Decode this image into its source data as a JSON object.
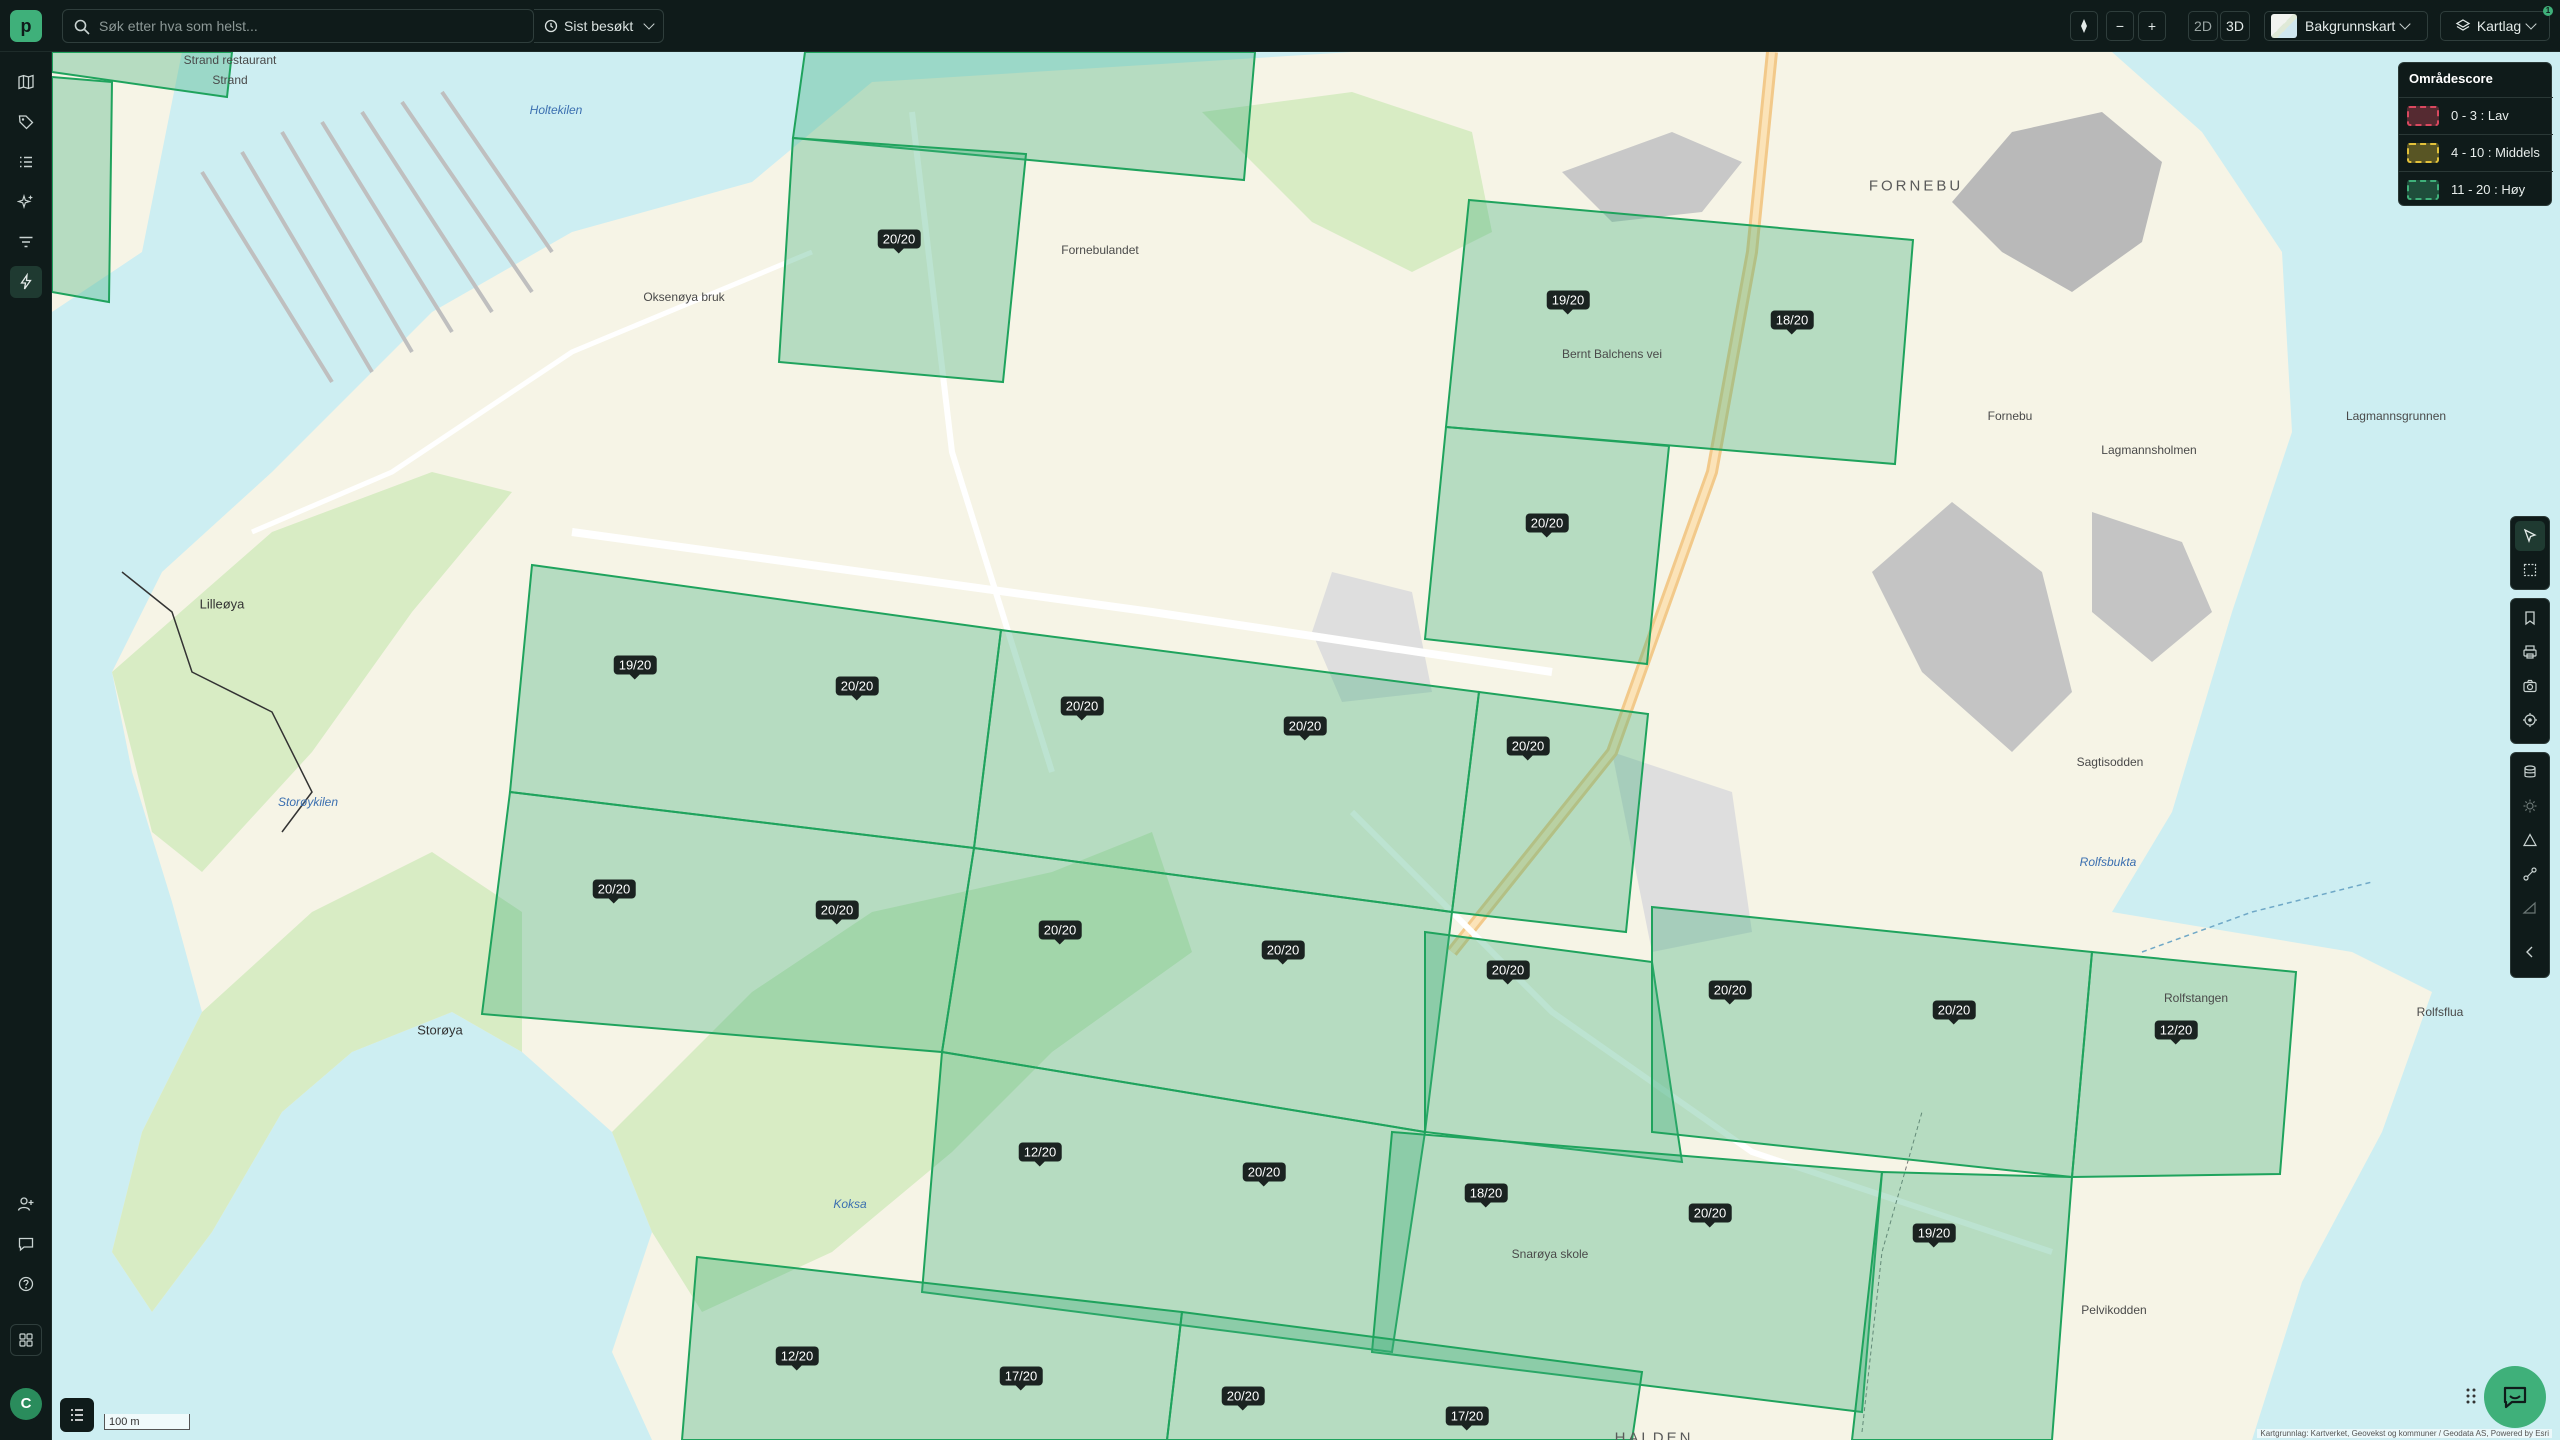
{
  "app": {
    "logo_letter": "p"
  },
  "search": {
    "placeholder": "Søk etter hva som helst..."
  },
  "toolbar": {
    "recent_label": "Sist besøkt",
    "zoom_out": "−",
    "zoom_in": "+",
    "view_2d": "2D",
    "view_3d": "3D",
    "basemap_label": "Bakgrunnskart",
    "layers_label": "Kartlag",
    "layers_badge": "1"
  },
  "user": {
    "avatar_initial": "C"
  },
  "legend": {
    "title": "Områdescore",
    "items": [
      {
        "label": "0 - 3 : Lav",
        "color": "#d9485f"
      },
      {
        "label": "4 - 10 : Middels",
        "color": "#e3c23a"
      },
      {
        "label": "11 - 20 : Høy",
        "color": "#3fb07a"
      }
    ]
  },
  "scores": [
    "20/20",
    "19/20",
    "18/20",
    "20/20",
    "19/20",
    "20/20",
    "20/20",
    "20/20",
    "20/20",
    "20/20",
    "20/20",
    "20/20",
    "20/20",
    "20/20",
    "20/20",
    "20/20",
    "12/20",
    "12/20",
    "20/20",
    "18/20",
    "20/20",
    "19/20",
    "12/20",
    "17/20",
    "20/20",
    "17/20"
  ],
  "places": {
    "strand_restaurant": "Strand restaurant",
    "strand": "Strand",
    "holtekilen": "Holtekilen",
    "oksenoya_bruk": "Oksenøya bruk",
    "fornebulandet": "Fornebulandet",
    "fornebu": "FORNEBU",
    "fornebu_small": "Fornebu",
    "lagmannsholmen": "Lagmannsholmen",
    "lagmannsgrunnen": "Lagmannsgrunnen",
    "lilleoya": "Lilleøya",
    "storoykilen": "Storøykilen",
    "storoya": "Storøya",
    "koksa": "Koksa",
    "saglisodden": "Sagtisodden",
    "rolfsbukta": "Rolfsbukta",
    "rolfsflua": "Rolfsflua",
    "pelvikodden": "Pelvikodden",
    "snaroya_skole": "Snarøya skole",
    "halden": "HALDEN",
    "bernt_balchens_vei": "Bernt Balchens vei",
    "rolfstangen": "Rolfstangen"
  },
  "scale": {
    "label": "100 m"
  },
  "attribution": "Kartgrunnlag: Kartverket, Geovekst og kommuner / Geodata AS, Powered by Esri"
}
